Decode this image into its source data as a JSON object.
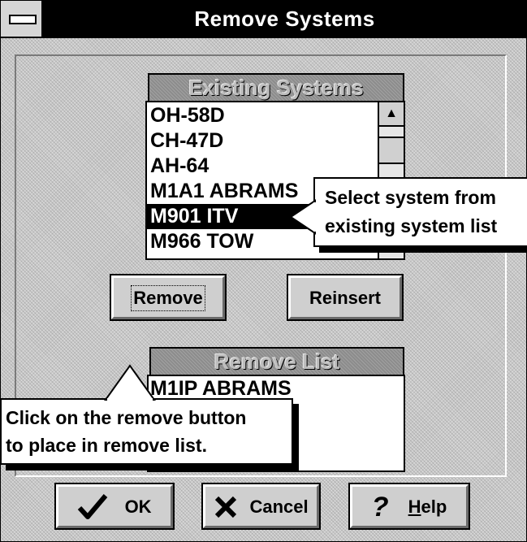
{
  "window": {
    "title": "Remove Systems"
  },
  "existing_list": {
    "header": "Existing Systems",
    "items": [
      {
        "label": "OH-58D",
        "selected": false
      },
      {
        "label": "CH-47D",
        "selected": false
      },
      {
        "label": "AH-64",
        "selected": false
      },
      {
        "label": "M1A1 ABRAMS",
        "selected": false
      },
      {
        "label": "M901 ITV",
        "selected": true
      },
      {
        "label": "M966 TOW",
        "selected": false
      }
    ]
  },
  "buttons": {
    "remove": "Remove",
    "reinsert": "Reinsert",
    "ok": "OK",
    "cancel": "Cancel",
    "help_prefix": "",
    "help_underlined": "H",
    "help_rest": "elp"
  },
  "remove_list": {
    "header": "Remove List",
    "items": [
      "M1IP ABRAMS"
    ]
  },
  "callouts": {
    "select": {
      "line1": "Select system from",
      "line2": "existing system list"
    },
    "remove": {
      "line1": "Click on the remove button",
      "line2": "to place in remove list."
    }
  },
  "icons": {
    "ok": "checkmark-icon",
    "cancel": "x-icon",
    "help": "question-mark-icon"
  }
}
